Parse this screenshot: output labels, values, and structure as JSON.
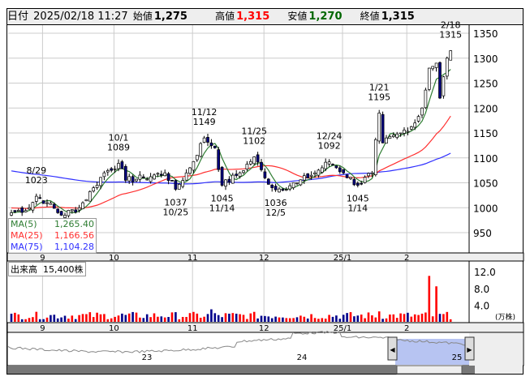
{
  "header": {
    "date_label": "日付",
    "datetime": "2025/02/18 11:27",
    "open_label": "始値",
    "open": "1,275",
    "high_label": "高値",
    "high": "1,315",
    "low_label": "安値",
    "low": "1,270",
    "close_label": "終値",
    "close": "1,315"
  },
  "ma": [
    {
      "label": "MA(5)",
      "value": "1,265.40",
      "color": "#2e7d32"
    },
    {
      "label": "MA(25)",
      "value": "1,166.56",
      "color": "#ff3030"
    },
    {
      "label": "MA(75)",
      "value": "1,104.28",
      "color": "#3030ff"
    }
  ],
  "volume": {
    "label": "出来高",
    "value": "15,400株",
    "unit": "(万株)"
  },
  "navigator": {
    "years": [
      "23",
      "24",
      "25"
    ]
  },
  "chart_data": {
    "type": "candlestick",
    "y_ticks": [
      1350,
      1300,
      1250,
      1200,
      1150,
      1100,
      1050,
      1000,
      950
    ],
    "ylim": [
      910,
      1355
    ],
    "x_ticks": [
      {
        "label": "9",
        "day": 11
      },
      {
        "label": "10",
        "day": 31
      },
      {
        "label": "11",
        "day": 53
      },
      {
        "label": "12",
        "day": 73
      },
      {
        "label": "25/1",
        "day": 95
      },
      {
        "label": "2",
        "day": 113
      }
    ],
    "close_keypoints": [
      [
        0,
        990
      ],
      [
        5,
        1000
      ],
      [
        7,
        1023
      ],
      [
        10,
        1010
      ],
      [
        14,
        985
      ],
      [
        19,
        1000
      ],
      [
        23,
        1040
      ],
      [
        26,
        1070
      ],
      [
        30,
        1089
      ],
      [
        32,
        1055
      ],
      [
        37,
        1060
      ],
      [
        43,
        1070
      ],
      [
        46,
        1037
      ],
      [
        50,
        1080
      ],
      [
        54,
        1140
      ],
      [
        57,
        1120
      ],
      [
        59,
        1045
      ],
      [
        64,
        1070
      ],
      [
        68,
        1102
      ],
      [
        71,
        1060
      ],
      [
        74,
        1036
      ],
      [
        80,
        1050
      ],
      [
        85,
        1070
      ],
      [
        89,
        1092
      ],
      [
        93,
        1070
      ],
      [
        97,
        1045
      ],
      [
        101,
        1070
      ],
      [
        103,
        1190
      ],
      [
        104,
        1130
      ],
      [
        109,
        1150
      ],
      [
        113,
        1170
      ],
      [
        115,
        1200
      ],
      [
        117,
        1280
      ],
      [
        119,
        1290
      ],
      [
        120,
        1220
      ],
      [
        122,
        1300
      ],
      [
        123,
        1315
      ]
    ],
    "annotations": [
      {
        "date": "8/29",
        "price": "1023",
        "day": 7,
        "pos": "above"
      },
      {
        "date": "10/1",
        "price": "1089",
        "day": 30,
        "pos": "above"
      },
      {
        "date": "10/25",
        "price": "1037",
        "day": 46,
        "pos": "below"
      },
      {
        "date": "11/12",
        "price": "1149",
        "day": 54,
        "pos": "above"
      },
      {
        "date": "11/14",
        "price": "1045",
        "day": 59,
        "pos": "below"
      },
      {
        "date": "11/25",
        "price": "1102",
        "day": 68,
        "pos": "above"
      },
      {
        "date": "12/5",
        "price": "1036",
        "day": 74,
        "pos": "below"
      },
      {
        "date": "12/24",
        "price": "1092",
        "day": 89,
        "pos": "above"
      },
      {
        "date": "1/14",
        "price": "1045",
        "day": 97,
        "pos": "below"
      },
      {
        "date": "1/21",
        "price": "1195",
        "day": 103,
        "pos": "above"
      },
      {
        "date": "2/18",
        "price": "1315",
        "day": 123,
        "pos": "above"
      }
    ],
    "volume_ticks": [
      "12.0",
      "8.0",
      "4.0"
    ],
    "volume_spikes": [
      [
        117,
        11
      ],
      [
        119,
        8.5
      ],
      [
        103,
        2.5
      ],
      [
        56,
        3
      ]
    ]
  }
}
